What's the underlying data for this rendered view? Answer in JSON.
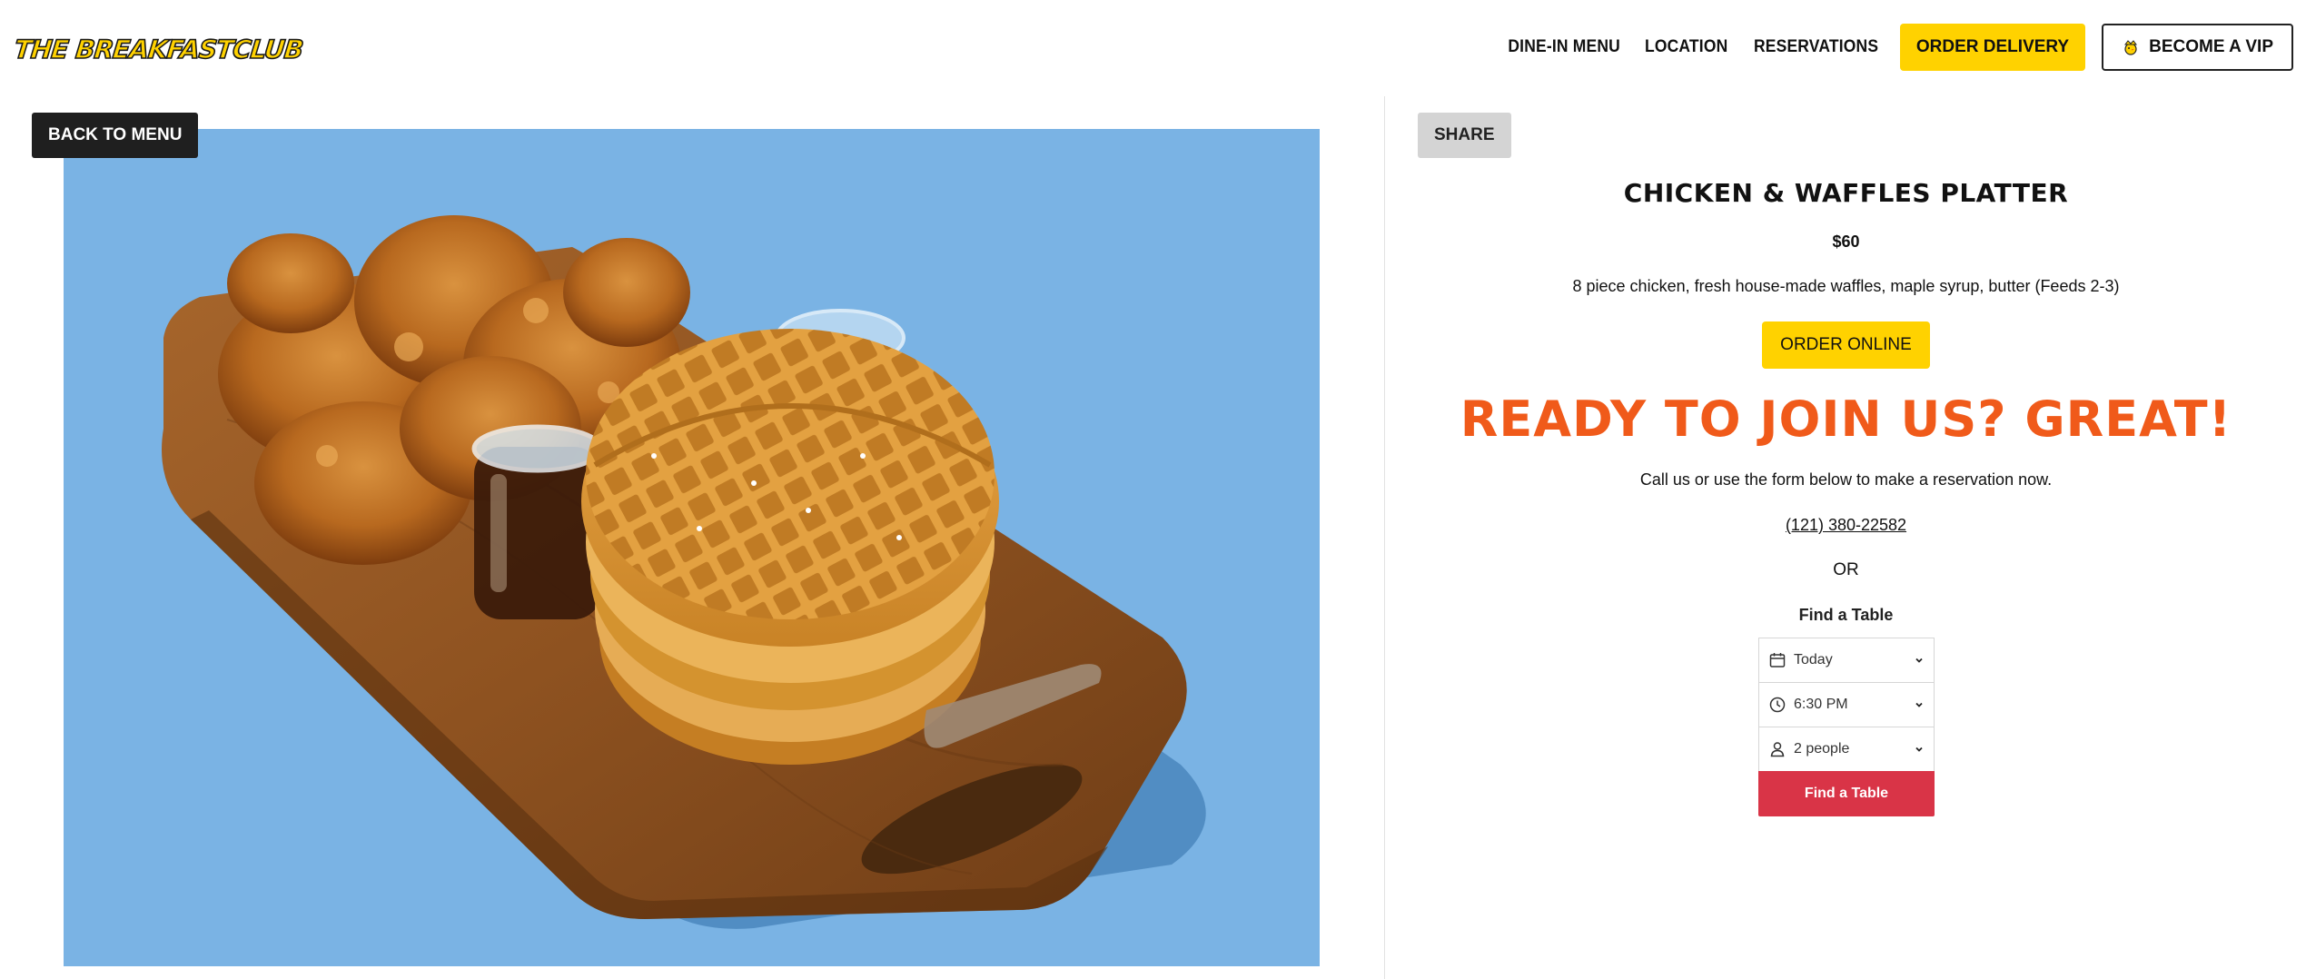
{
  "header": {
    "logo_text_main": "The BreakfastClub",
    "nav": [
      {
        "label": "DINE-IN MENU"
      },
      {
        "label": "LOCATION"
      },
      {
        "label": "RESERVATIONS"
      }
    ],
    "order_delivery_label": "ORDER DELIVERY",
    "become_vip_label": "BECOME A VIP",
    "vip_icon": "crown-chick-icon"
  },
  "left": {
    "back_label": "BACK TO MENU",
    "photo_icon": "chicken-and-waffles-photo"
  },
  "right": {
    "share_label": "SHARE",
    "item_title": "CHICKEN & WAFFLES PLATTER",
    "price": "$60",
    "description": "8 piece chicken, fresh house-made waffles, maple syrup, butter (Feeds 2-3)",
    "order_online_label": "ORDER ONLINE",
    "headline": "READY TO JOIN US? GREAT!",
    "subtext": "Call us or use the form below to make a reservation now.",
    "phone": "(121) 380-22582",
    "or_text": "OR",
    "find_table_title": "Find a Table",
    "widget": {
      "date_value": "Today",
      "time_value": "6:30 PM",
      "party_value": "2 people",
      "submit_label": "Find a Table"
    }
  },
  "colors": {
    "accent_yellow": "#ffd200",
    "headline_orange": "#f05a1a",
    "find_button_red": "#d93447",
    "photo_background_blue": "#7ab3e4"
  }
}
